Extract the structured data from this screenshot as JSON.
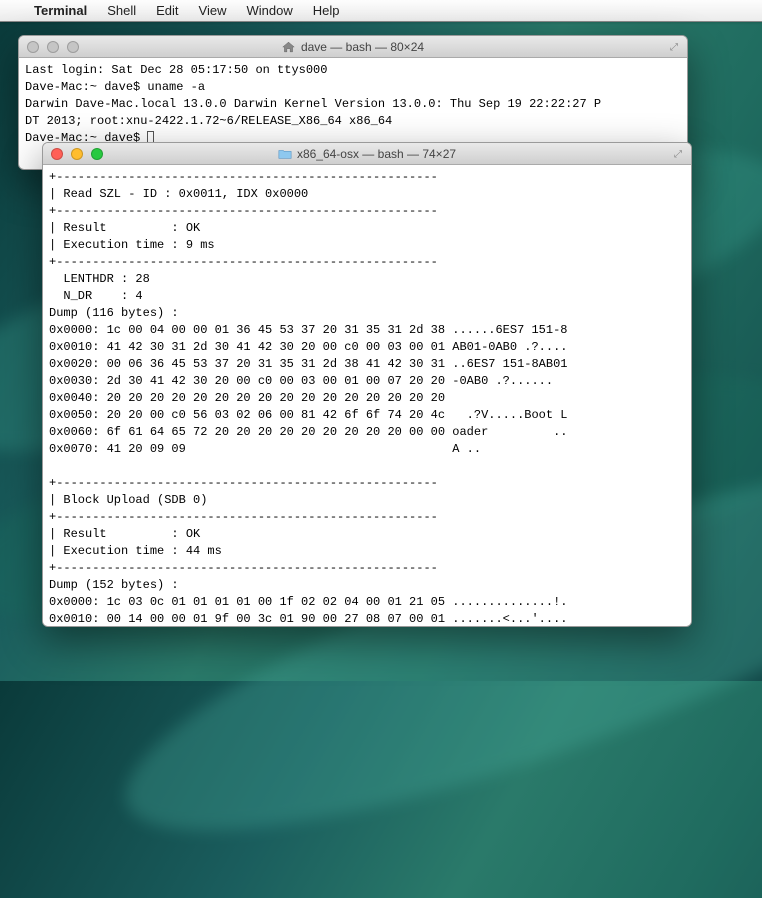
{
  "menubar": {
    "app": "Terminal",
    "items": [
      "Shell",
      "Edit",
      "View",
      "Window",
      "Help"
    ]
  },
  "window_back": {
    "title": "dave — bash — 80×24",
    "lines": [
      "Last login: Sat Dec 28 05:17:50 on ttys000",
      "Dave-Mac:~ dave$ uname -a",
      "Darwin Dave-Mac.local 13.0.0 Darwin Kernel Version 13.0.0: Thu Sep 19 22:22:27 P",
      "DT 2013; root:xnu-2422.1.72~6/RELEASE_X86_64 x86_64",
      "Dave-Mac:~ dave$ "
    ]
  },
  "window_front": {
    "title": "x86_64-osx — bash — 74×27",
    "lines": [
      "+-----------------------------------------------------",
      "| Read SZL - ID : 0x0011, IDX 0x0000",
      "+-----------------------------------------------------",
      "| Result         : OK",
      "| Execution time : 9 ms",
      "+-----------------------------------------------------",
      "  LENTHDR : 28",
      "  N_DR    : 4",
      "Dump (116 bytes) :",
      "0x0000: 1c 00 04 00 00 01 36 45 53 37 20 31 35 31 2d 38 ......6ES7 151-8",
      "0x0010: 41 42 30 31 2d 30 41 42 30 20 00 c0 00 03 00 01 AB01-0AB0 .?....",
      "0x0020: 00 06 36 45 53 37 20 31 35 31 2d 38 41 42 30 31 ..6ES7 151-8AB01",
      "0x0030: 2d 30 41 42 30 20 00 c0 00 03 00 01 00 07 20 20 -0AB0 .?......  ",
      "0x0040: 20 20 20 20 20 20 20 20 20 20 20 20 20 20 20 20",
      "0x0050: 20 20 00 c0 56 03 02 06 00 81 42 6f 6f 74 20 4c   .?V.....Boot L",
      "0x0060: 6f 61 64 65 72 20 20 20 20 20 20 20 20 20 00 00 oader         ..",
      "0x0070: 41 20 09 09                                     A ..",
      "",
      "+-----------------------------------------------------",
      "| Block Upload (SDB 0)",
      "+-----------------------------------------------------",
      "| Result         : OK",
      "| Execution time : 44 ms",
      "+-----------------------------------------------------",
      "Dump (152 bytes) :",
      "0x0000: 1c 03 0c 01 01 01 01 00 1f 02 02 04 00 01 21 05 ..............!.",
      "0x0010: 00 14 00 00 01 9f 00 3c 01 90 00 27 08 07 00 01 .......<...'...."
    ]
  }
}
